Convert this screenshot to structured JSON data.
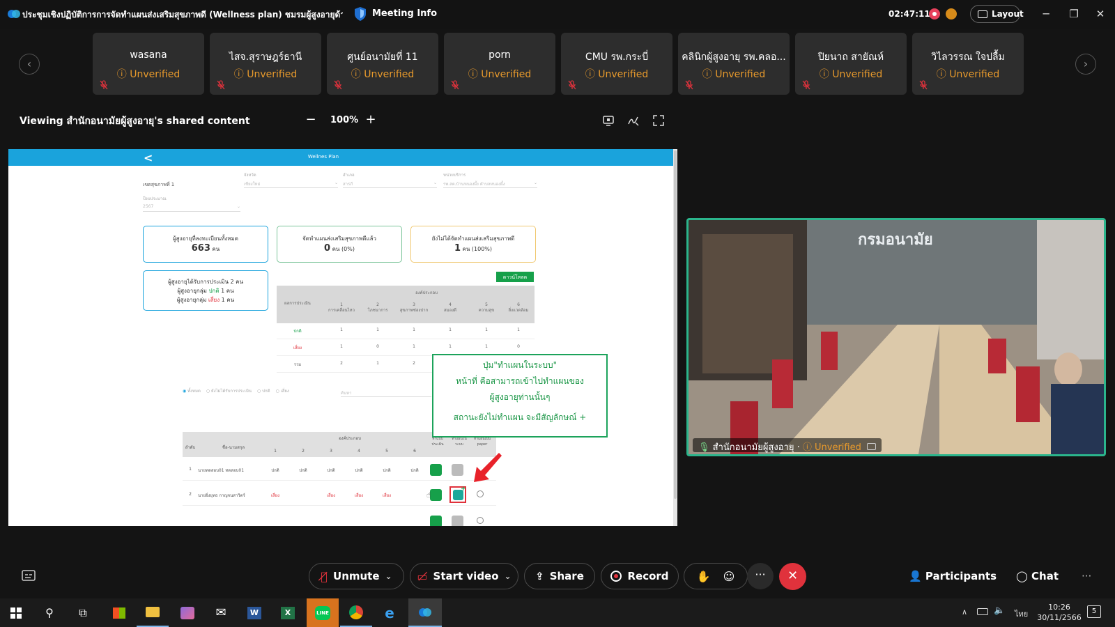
{
  "titlebar": {
    "meeting_title": "ประชุมเชิงปฏิบัติการการจัดทำแผนส่งเสริมสุขภาพดี (Wellness plan) ชมรมผู้สูงอายุด้าน...",
    "meeting_info": "Meeting Info",
    "timer": "02:47:11",
    "layout_label": "Layout"
  },
  "participants_strip": [
    {
      "name": "wasana",
      "status": "Unverified"
    },
    {
      "name": "ไสจ.สุราษฎร์ธานี",
      "status": "Unverified"
    },
    {
      "name": "ศูนย์อนามัยที่ 11",
      "status": "Unverified"
    },
    {
      "name": "porn",
      "status": "Unverified"
    },
    {
      "name": "CMU รพ.กระบี่",
      "status": "Unverified"
    },
    {
      "name": "คลินิกผู้สูงอายุ รพ.คลอ...",
      "status": "Unverified"
    },
    {
      "name": "ปิยนาถ สายัณห์",
      "status": "Unverified"
    },
    {
      "name": "วิไลวรรณ ใจปลื้ม",
      "status": "Unverified"
    }
  ],
  "viewer": {
    "viewing_text": "Viewing สำนักอนามัยผู้สูงอายุ's shared content",
    "zoom": "100%"
  },
  "shared_screen": {
    "app_title": "Wellnes Plan",
    "health_zone": "เขตสุขภาพที่ 1",
    "filters": [
      {
        "label": "จังหวัด",
        "value": "เชียงใหม่"
      },
      {
        "label": "อำเภอ",
        "value": "สารภี"
      },
      {
        "label": "หน่วยบริการ",
        "value": "รพ.สต.บ้านหนองผึ้ง ตำบลหนองผึ้ง"
      }
    ],
    "year_label": "ปีงบประมาณ",
    "year_value": "2567",
    "cards": [
      {
        "title": "ผู้สูงอายุที่ลงทะเบียนทั้งหมด",
        "value": "663",
        "unit": "คน"
      },
      {
        "title": "จัดทำแผนส่งเสริมสุขภาพดีแล้ว",
        "value": "0",
        "unit": "คน (0%)"
      },
      {
        "title": "ยังไม่ได้จัดทำแผนส่งเสริมสุขภาพดี",
        "value": "1",
        "unit": "คน (100%)"
      }
    ],
    "assessed": {
      "line1": "ผู้สูงอายุได้รับการประเมิน 2 คน",
      "line2_prefix": "ผู้สูงอายุกลุ่ม",
      "line2_word": "ปกติ",
      "line2_suffix": "1 คน",
      "line3_prefix": "ผู้สูงอายุกลุ่ม",
      "line3_word": "เสี่ยง",
      "line3_suffix": "1 คน"
    },
    "download_label": "ดาวน์โหลด",
    "summary_table": {
      "header": "องค์ประกอบ",
      "row_label": "ผลการประเมิน",
      "columns": [
        {
          "num": "1",
          "name": "การเคลื่อนไหว"
        },
        {
          "num": "2",
          "name": "โภชนาการ"
        },
        {
          "num": "3",
          "name": "สุขภาพช่องปาก"
        },
        {
          "num": "4",
          "name": "สมองดี"
        },
        {
          "num": "5",
          "name": "ความสุข"
        },
        {
          "num": "6",
          "name": "สิ่งแวดล้อม"
        }
      ],
      "rows": [
        {
          "label": "ปกติ",
          "values": [
            "1",
            "1",
            "1",
            "1",
            "1",
            "1"
          ]
        },
        {
          "label": "เสี่ยง",
          "values": [
            "1",
            "0",
            "1",
            "1",
            "1",
            "0"
          ]
        },
        {
          "label": "รวม",
          "values": [
            "2",
            "1",
            "2",
            "",
            "",
            ""
          ]
        }
      ]
    },
    "radio_filters": [
      "ทั้งหมด",
      "ยังไม่ได้รับการประเมิน",
      "ปกติ",
      "เสี่ยง"
    ],
    "search_placeholder": "ค้นหา",
    "list_table": {
      "col_index": "ลำดับ",
      "col_name": "ชื่อ-นามสกุล",
      "group": "องค์ประกอบ",
      "nums": [
        "1",
        "2",
        "3",
        "4",
        "5",
        "6"
      ],
      "col_assess": "ทำแบบประเมิน",
      "col_plan_system": "ทำแผนในระบบ",
      "col_plan_paper": "ทำแผนเป็น paper",
      "rows": [
        {
          "index": "1",
          "name": "นายทดสอบ01 ทดสอบ01",
          "values": [
            "ปกติ",
            "ปกติ",
            "ปกติ",
            "ปกติ",
            "ปกติ",
            "ปกติ"
          ]
        },
        {
          "index": "2",
          "name": "นายยิ่งยุทธ กาญจนสาวิตร์",
          "values": [
            "เสี่ยง",
            "",
            "เสี่ยง",
            "เสี่ยง",
            "เสี่ยง",
            ""
          ]
        }
      ]
    },
    "callout": {
      "line1": "ปุ่ม\"ทำแผนในระบบ\"",
      "line2": "หน้าที่ คือสามารถเข้าไปทำแผนของ",
      "line3": "ผู้สูงอายุท่านนั้นๆ",
      "line4": "สถานะยังไม่ทำแผน จะมีสัญลักษณ์ +"
    }
  },
  "video": {
    "wall_text": "กรมอนามัย",
    "name": "สำนักอนามัยผู้สูงอายุ",
    "status": "Unverified"
  },
  "controls": {
    "unmute": "Unmute",
    "start_video": "Start video",
    "share": "Share",
    "record": "Record",
    "participants": "Participants",
    "chat": "Chat"
  },
  "taskbar": {
    "lang": "ไทย",
    "time": "10:26",
    "date": "30/11/2566",
    "notifications": "5"
  },
  "colors": {
    "accent_blue": "#1aa3dc",
    "green": "#16a04a",
    "warning": "#e89a2c",
    "end_red": "#e0323c"
  }
}
